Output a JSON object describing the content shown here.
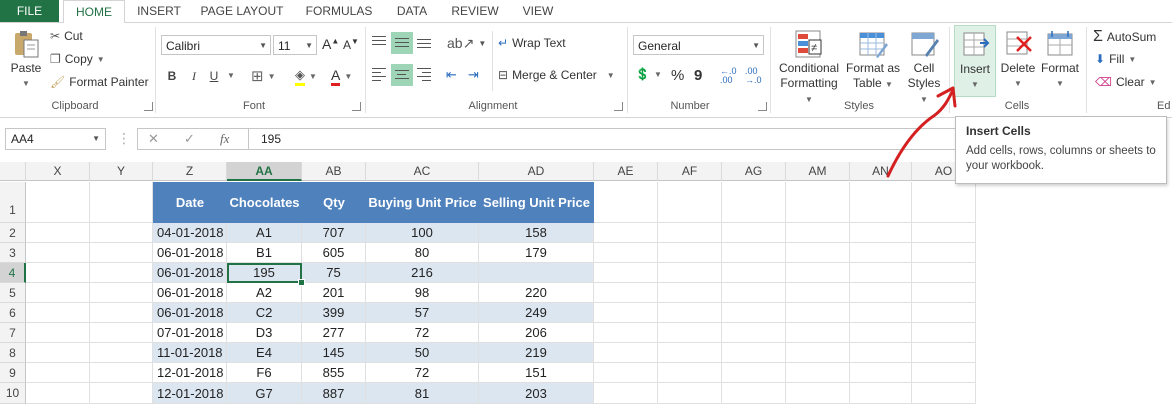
{
  "tabs": [
    "FILE",
    "HOME",
    "INSERT",
    "PAGE LAYOUT",
    "FORMULAS",
    "DATA",
    "REVIEW",
    "VIEW"
  ],
  "clipboard": {
    "paste": "Paste",
    "cut": "Cut",
    "copy": "Copy",
    "format_painter": "Format Painter",
    "label": "Clipboard"
  },
  "font": {
    "name": "Calibri",
    "size": "11",
    "bold": "B",
    "italic": "I",
    "underline": "U",
    "label": "Font"
  },
  "alignment": {
    "wrap_text": "Wrap Text",
    "merge_center": "Merge & Center",
    "label": "Alignment"
  },
  "number": {
    "format": "General",
    "percent": "%",
    "comma": "9",
    "label": "Number"
  },
  "styles": {
    "conditional_1": "Conditional",
    "conditional_2": "Formatting",
    "format_as_1": "Format as",
    "format_as_2": "Table",
    "cell_styles_1": "Cell",
    "cell_styles_2": "Styles",
    "label": "Styles"
  },
  "cells": {
    "insert": "Insert",
    "delete": "Delete",
    "format": "Format",
    "label": "Cells"
  },
  "editing": {
    "autosum": "AutoSum",
    "fill": "Fill",
    "clear": "Clear",
    "label": "Ed"
  },
  "tooltip": {
    "title": "Insert Cells",
    "body": "Add cells, rows, columns or sheets to your workbook."
  },
  "formula_bar": {
    "name_box": "AA4",
    "value": "195",
    "fx": "fx"
  },
  "columns": [
    "X",
    "Y",
    "Z",
    "AA",
    "AB",
    "AC",
    "AD",
    "AE",
    "AF",
    "AG",
    "AM",
    "AN",
    "AO"
  ],
  "rows": [
    "1",
    "2",
    "3",
    "4",
    "5",
    "6",
    "7",
    "8",
    "9",
    "10"
  ],
  "table": {
    "headers": [
      "Date",
      "Chocolates",
      "Qty",
      "Buying Unit Price",
      "Selling Unit Price"
    ],
    "rows": [
      [
        "04-01-2018",
        "A1",
        "707",
        "100",
        "158"
      ],
      [
        "06-01-2018",
        "B1",
        "605",
        "80",
        "179"
      ],
      [
        "06-01-2018",
        "195",
        "75",
        "216",
        ""
      ],
      [
        "06-01-2018",
        "A2",
        "201",
        "98",
        "220"
      ],
      [
        "06-01-2018",
        "C2",
        "399",
        "57",
        "249"
      ],
      [
        "07-01-2018",
        "D3",
        "277",
        "72",
        "206"
      ],
      [
        "11-01-2018",
        "E4",
        "145",
        "50",
        "219"
      ],
      [
        "12-01-2018",
        "F6",
        "855",
        "72",
        "151"
      ],
      [
        "12-01-2018",
        "G7",
        "887",
        "81",
        "203"
      ]
    ]
  },
  "colors": {
    "excel_green": "#217346",
    "table_header": "#4f81bd",
    "band": "#dce6f1",
    "annotation": "#d42020"
  }
}
